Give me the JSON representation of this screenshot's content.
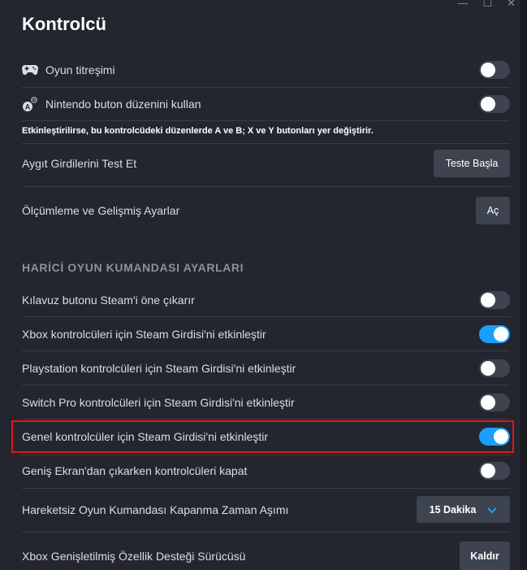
{
  "page": {
    "title": "Kontrolcü"
  },
  "colors": {
    "toggle_on": "#1a9fff",
    "toggle_off": "#3d4450",
    "highlight": "#e1141b"
  },
  "rows_top": [
    {
      "label": "Oyun titreşimi",
      "icon": "gamepad-icon",
      "toggle": false
    },
    {
      "label": "Nintendo buton düzenini kullan",
      "icon": "nintendo-buttons-icon",
      "toggle": false
    }
  ],
  "nintendo_desc": "Etkinleştirilirse, bu kontrolcüdeki düzenlerde A ve B; X ve Y butonları yer değiştirir.",
  "test_inputs": {
    "label": "Aygıt Girdilerini Test Et",
    "button": "Teste Başla"
  },
  "calibration": {
    "label": "Ölçümleme ve Gelişmiş Ayarlar",
    "button": "Aç"
  },
  "section_title": "HARİCİ OYUN KUMANDASI AYARLARI",
  "toggles": [
    {
      "label": "Kılavuz butonu Steam'i öne çıkarır",
      "on": false
    },
    {
      "label": "Xbox kontrolcüleri için Steam Girdisi'ni etkinleştir",
      "on": true
    },
    {
      "label": "Playstation kontrolcüleri için Steam Girdisi'ni etkinleştir",
      "on": false
    },
    {
      "label": "Switch Pro kontrolcüleri için Steam Girdisi'ni etkinleştir",
      "on": false
    },
    {
      "label": "Genel kontrolcüler için Steam Girdisi'ni etkinleştir",
      "on": true
    },
    {
      "label": "Geniş Ekran'dan çıkarken kontrolcüleri kapat",
      "on": false
    }
  ],
  "idle_timeout": {
    "label": "Hareketsiz Oyun Kumandası Kapanma Zaman Aşımı",
    "value": "15 Dakika"
  },
  "xbox_driver": {
    "label": "Xbox Genişletilmiş Özellik Desteği Sürücüsü",
    "button": "Kaldır"
  }
}
